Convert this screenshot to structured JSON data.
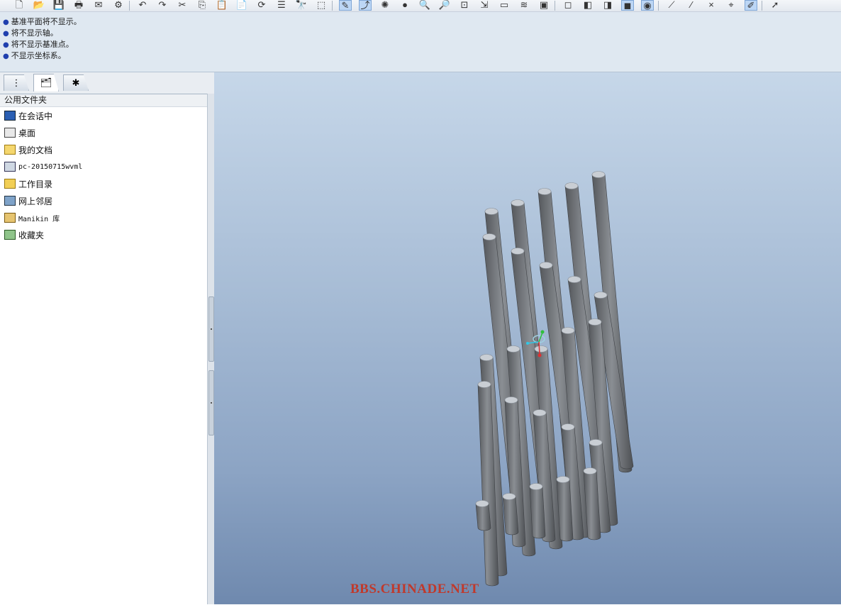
{
  "toolbar": {
    "groups": [
      [
        "new-file-icon",
        "open-file-icon",
        "save-icon",
        "print-icon",
        "send-mail-icon",
        "mail-merge-icon"
      ],
      [
        "undo-icon",
        "redo-icon",
        "cut-icon",
        "copy-icon",
        "paste-icon",
        "paste-special-icon",
        "regenerate-icon",
        "regenerate-manager-icon",
        "find-icon",
        "select-box-icon"
      ],
      [
        "sketch-icon",
        "datum-display-icon",
        "spin-center-icon",
        "shading-icon",
        "zoom-in-icon",
        "zoom-out-icon",
        "refit-icon",
        "reorient-icon",
        "saved-view-icon",
        "layers-icon",
        "view-manager-icon"
      ],
      [
        "wireframe-icon",
        "hidden-line-icon",
        "no-hidden-icon",
        "shaded-icon",
        "enhanced-realism-icon"
      ],
      [
        "datum-planes-icon",
        "datum-axes-icon",
        "datum-points-icon",
        "coordinate-systems-icon",
        "annotation-icon"
      ],
      [
        "select-arrow-icon"
      ]
    ],
    "glyphs": {
      "new-file-icon": "🗋",
      "open-file-icon": "📂",
      "save-icon": "💾",
      "print-icon": "🖶",
      "send-mail-icon": "✉",
      "mail-merge-icon": "⚙",
      "undo-icon": "↶",
      "redo-icon": "↷",
      "cut-icon": "✂",
      "copy-icon": "⎘",
      "paste-icon": "📋",
      "paste-special-icon": "📄",
      "regenerate-icon": "⟳",
      "regenerate-manager-icon": "☰",
      "find-icon": "🔭",
      "select-box-icon": "⬚",
      "sketch-icon": "✎",
      "datum-display-icon": "⤴",
      "spin-center-icon": "✺",
      "shading-icon": "●",
      "zoom-in-icon": "🔍",
      "zoom-out-icon": "🔎",
      "refit-icon": "⊡",
      "reorient-icon": "⇲",
      "saved-view-icon": "▭",
      "layers-icon": "≋",
      "view-manager-icon": "▣",
      "wireframe-icon": "◻",
      "hidden-line-icon": "◧",
      "no-hidden-icon": "◨",
      "shaded-icon": "◼",
      "enhanced-realism-icon": "◉",
      "datum-planes-icon": "⟋",
      "datum-axes-icon": "⁄",
      "datum-points-icon": "×",
      "coordinate-systems-icon": "⌖",
      "annotation-icon": "✐",
      "select-arrow-icon": "➚"
    },
    "active": [
      "sketch-icon",
      "datum-display-icon",
      "shaded-icon",
      "enhanced-realism-icon",
      "annotation-icon"
    ]
  },
  "messages": [
    "基准平面将不显示。",
    "将不显示轴。",
    "将不显示基准点。",
    "不显示坐标系。"
  ],
  "navigator": {
    "tabs": [
      {
        "name": "tab-model-tree",
        "glyph": "⋮"
      },
      {
        "name": "tab-folder-browser",
        "glyph": "🗂"
      },
      {
        "name": "tab-favorites",
        "glyph": "✱"
      }
    ],
    "active_tab": 1,
    "folder_header": "公用文件夹",
    "items": [
      {
        "label": "在会话中",
        "icon": "in-session-icon",
        "mono": false
      },
      {
        "label": "桌面",
        "icon": "desktop-icon",
        "mono": false
      },
      {
        "label": "我的文档",
        "icon": "my-documents-icon",
        "mono": false
      },
      {
        "label": "pc-20150715wvml",
        "icon": "computer-icon",
        "mono": true
      },
      {
        "label": "工作目录",
        "icon": "working-directory-icon",
        "mono": false
      },
      {
        "label": "网上邻居",
        "icon": "network-icon",
        "mono": false
      },
      {
        "label": "Manikin 库",
        "icon": "manikin-library-icon",
        "mono": true
      },
      {
        "label": "收藏夹",
        "icon": "favorites-icon",
        "mono": false
      }
    ]
  },
  "viewport": {
    "watermark": "BBS.CHINADE.NET",
    "model": {
      "description_colors": {
        "cylinder_body": "#6e7175",
        "cylinder_top": "#c9ced4"
      },
      "rows": 5
    }
  }
}
